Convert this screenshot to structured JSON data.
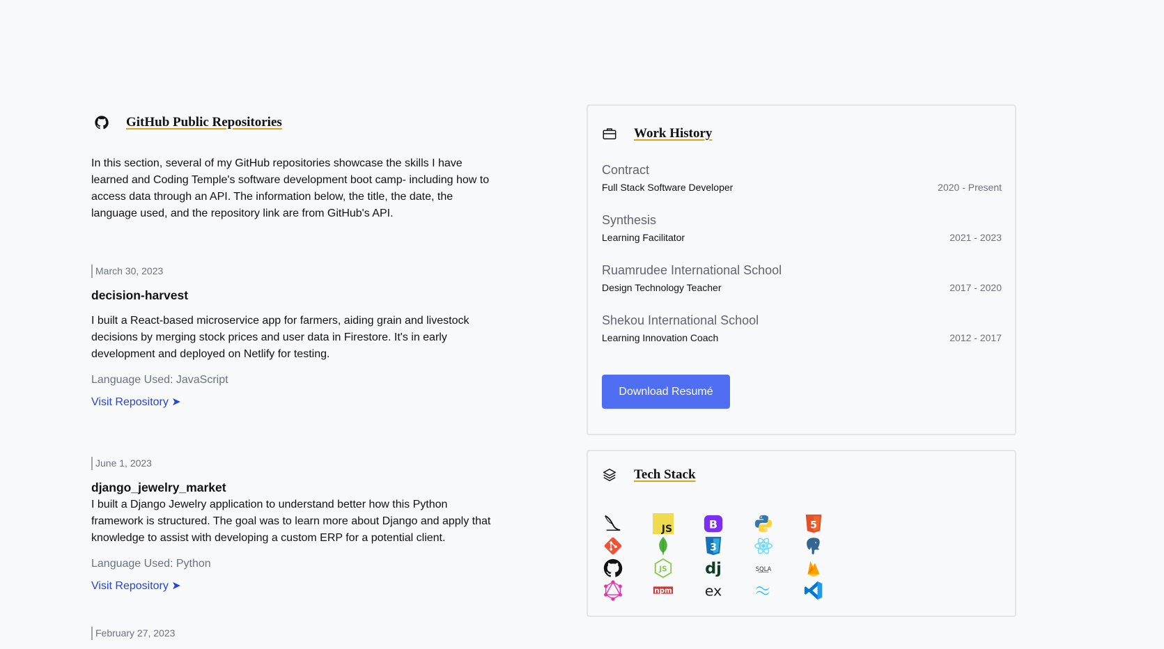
{
  "github": {
    "title": "GitHub Public Repositories",
    "intro": "In this section, several of my GitHub repositories showcase the skills I have learned and Coding Temple's software development boot camp- including how to access data through an API. The information below, the title, the date, the language used, and the repository link are from GitHub's API.",
    "repos": [
      {
        "date": "March 30, 2023",
        "name": "decision-harvest",
        "description": "I built a React-based microservice app for farmers, aiding grain and livestock decisions by merging stock prices and user data in Firestore. It's in early development and deployed on Netlify for testing.",
        "language": "Language Used: JavaScript",
        "link": "Visit Repository ➤"
      },
      {
        "date": "June 1, 2023",
        "name": "django_jewelry_market",
        "description": "I built a Django Jewelry application to understand better how this Python framework is structured. The goal was to learn more about Django and apply that knowledge to assist with developing a custom ERP for a potential client.",
        "language": "Language Used: Python",
        "link": "Visit Repository ➤"
      },
      {
        "date": "February 27, 2023"
      }
    ]
  },
  "work": {
    "title": "Work History",
    "jobs": [
      {
        "company": "Contract",
        "role": "Full Stack Software Developer",
        "dates": "2020 - Present"
      },
      {
        "company": "Synthesis",
        "role": "Learning Facilitator",
        "dates": "2021 - 2023"
      },
      {
        "company": "Ruamrudee International School",
        "role": "Design Technology Teacher",
        "dates": "2017 - 2020"
      },
      {
        "company": "Shekou International School",
        "role": "Learning Innovation Coach",
        "dates": "2012 - 2017"
      }
    ],
    "download_label": "Download Resumé"
  },
  "tech": {
    "title": "Tech Stack",
    "icons": [
      "flask-icon",
      "javascript-icon",
      "bootstrap-icon",
      "python-icon",
      "html5-icon",
      "git-icon",
      "mongodb-icon",
      "css3-icon",
      "react-icon",
      "postgresql-icon",
      "github-icon",
      "nodejs-icon",
      "django-icon",
      "sqlalchemy-icon",
      "firebase-icon",
      "graphql-icon",
      "npm-icon",
      "express-icon",
      "tailwind-icon",
      "vscode-icon"
    ],
    "logo_text": {
      "js": "JS",
      "bootstrap": "B",
      "django": "dj",
      "sqlalchemy": "SQLA",
      "npm": "npm",
      "express": "ex",
      "html5": "5",
      "css3": "3"
    }
  }
}
